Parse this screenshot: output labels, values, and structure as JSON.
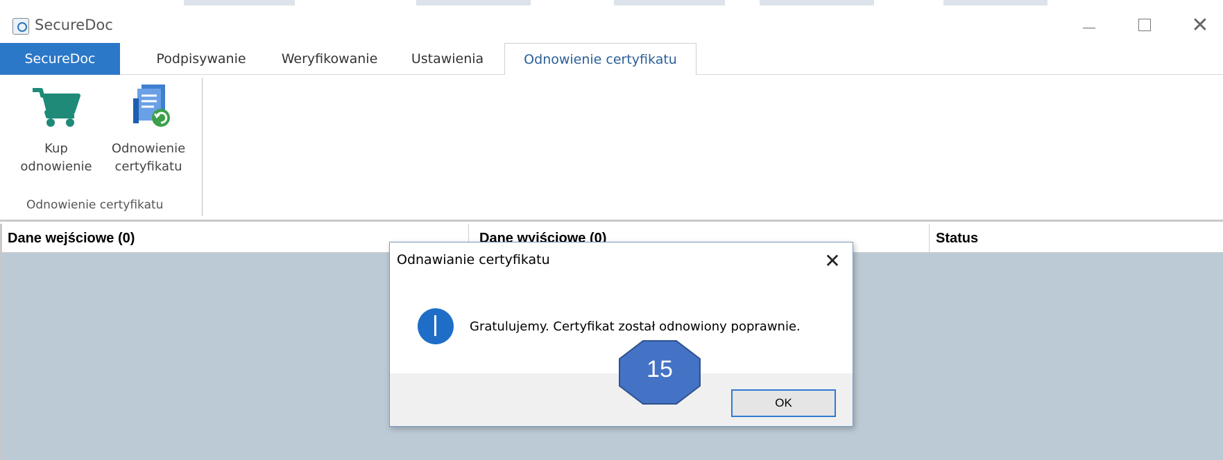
{
  "window": {
    "title": "SecureDoc",
    "minimize_icon": "minimize-icon",
    "maximize_icon": "maximize-icon",
    "close_glyph": "✕"
  },
  "tabs": [
    {
      "label": "SecureDoc",
      "state": "file"
    },
    {
      "label": "Podpisywanie",
      "state": "normal"
    },
    {
      "label": "Weryfikowanie",
      "state": "normal"
    },
    {
      "label": "Ustawienia",
      "state": "normal"
    },
    {
      "label": "Odnowienie certyfikatu",
      "state": "active"
    }
  ],
  "ribbon": {
    "buttons": [
      {
        "label": "Kup\nodnowienie",
        "icon": "cart-icon"
      },
      {
        "label": "Odnowienie\ncertyfikatu",
        "icon": "certificate-renew-icon"
      }
    ],
    "group_label": "Odnowienie certyfikatu"
  },
  "grid": {
    "columns": [
      "Dane wejściowe (0)",
      "Dane wyjściowe (0)",
      "Status"
    ]
  },
  "dialog": {
    "title": "Odnawianie certyfikatu",
    "close_glyph": "✕",
    "icon": "info-icon",
    "message": "Gratulujemy. Certyfikat został odnowiony poprawnie.",
    "ok_label": "OK"
  },
  "annotation": {
    "step_number": "15"
  },
  "colors": {
    "file_tab": "#2b78c9",
    "active_tab_text": "#2b5e97",
    "grid_background": "#bccad6",
    "cart_green": "#1f8a78",
    "info_blue": "#1e6ec8",
    "badge_fill": "#4472c4",
    "badge_stroke": "#2f528f"
  }
}
